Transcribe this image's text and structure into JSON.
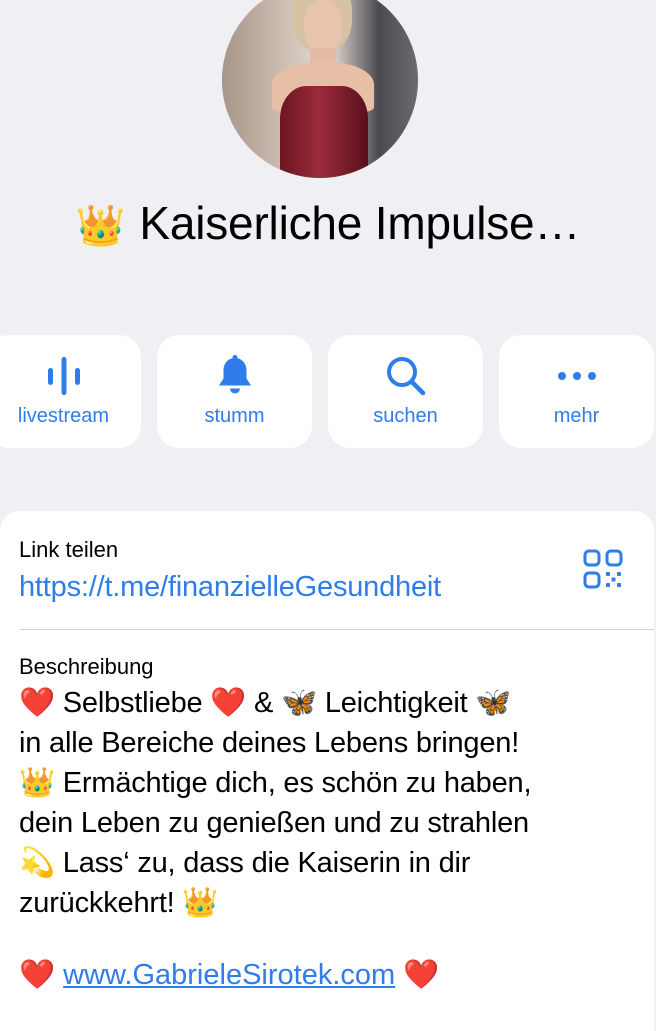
{
  "header": {
    "title_icon": "crown-emoji",
    "title_crown": "👑",
    "title": "Kaiserliche Impulse…"
  },
  "actions": [
    {
      "label": "livestream",
      "icon": "livestream-icon"
    },
    {
      "label": "stumm",
      "icon": "bell-icon"
    },
    {
      "label": "suchen",
      "icon": "search-icon"
    },
    {
      "label": "mehr",
      "icon": "more-icon"
    }
  ],
  "link": {
    "label": "Link teilen",
    "url": "https://t.me/finanzielleGesundheit",
    "qr_icon": "qr-code-icon"
  },
  "description": {
    "label": "Beschreibung",
    "lines": [
      "❤️ Selbstliebe ❤️ & 🦋 Leichtigkeit 🦋",
      "in alle Bereiche deines Lebens bringen!",
      "👑 Ermächtige dich, es schön zu haben,",
      "dein Leben zu genießen und zu strahlen",
      "💫 Lass‘ zu, dass die Kaiserin in dir",
      "zurückkehrt! 👑"
    ],
    "footer_heart_left": "❤️",
    "website": "www.GabrieleSirotek.com",
    "footer_heart_right": "❤️"
  },
  "colors": {
    "accent": "#2f7dea",
    "background": "#efeff4",
    "card": "#ffffff"
  }
}
